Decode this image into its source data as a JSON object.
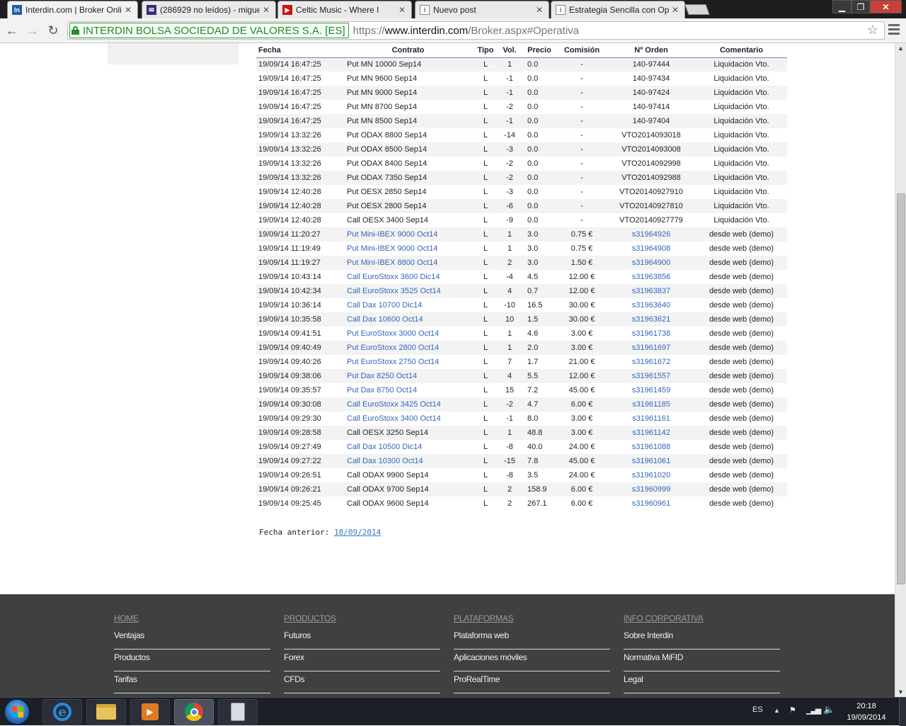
{
  "browser": {
    "tabs": [
      {
        "title": "Interdin.com | Broker Onli",
        "icon": "interdin-icon",
        "active": true
      },
      {
        "title": "(286929 no leídos) - migue",
        "icon": "mail-icon",
        "active": false
      },
      {
        "title": "Celtic Music - Where I",
        "icon": "youtube-icon",
        "active": false
      },
      {
        "title": "Nuevo post",
        "icon": "page-icon",
        "active": false
      },
      {
        "title": "Estrategia Sencilla con Op",
        "icon": "page-icon",
        "active": false
      }
    ],
    "ev_label": "INTERDIN BOLSA SOCIEDAD DE VALORES S.A. [ES]",
    "url_scheme": "https://",
    "url_host": "www.interdin.com",
    "url_path": "/Broker.aspx#Operativa"
  },
  "table": {
    "headers": {
      "fecha": "Fecha",
      "contrato": "Contrato",
      "tipo": "Tipo",
      "vol": "Vol.",
      "precio": "Precio",
      "comision": "Comisión",
      "orden": "Nº Orden",
      "comentario": "Comentario"
    },
    "rows": [
      {
        "fecha": "19/09/14 16:47:25",
        "contrato": "Put MN 10000 Sep14",
        "tipo": "L",
        "vol": "1",
        "precio": "0.0",
        "comision": "-",
        "orden": "140-97444",
        "comentario": "Liquidación Vto.",
        "link": false
      },
      {
        "fecha": "19/09/14 16:47:25",
        "contrato": "Put MN 9600 Sep14",
        "tipo": "L",
        "vol": "-1",
        "precio": "0.0",
        "comision": "-",
        "orden": "140-97434",
        "comentario": "Liquidación Vto.",
        "link": false
      },
      {
        "fecha": "19/09/14 16:47:25",
        "contrato": "Put MN 9000 Sep14",
        "tipo": "L",
        "vol": "-1",
        "precio": "0.0",
        "comision": "-",
        "orden": "140-97424",
        "comentario": "Liquidación Vto.",
        "link": false
      },
      {
        "fecha": "19/09/14 16:47:25",
        "contrato": "Put MN 8700 Sep14",
        "tipo": "L",
        "vol": "-2",
        "precio": "0.0",
        "comision": "-",
        "orden": "140-97414",
        "comentario": "Liquidación Vto.",
        "link": false
      },
      {
        "fecha": "19/09/14 16:47:25",
        "contrato": "Put MN 8500 Sep14",
        "tipo": "L",
        "vol": "-1",
        "precio": "0.0",
        "comision": "-",
        "orden": "140-97404",
        "comentario": "Liquidación Vto.",
        "link": false
      },
      {
        "fecha": "19/09/14 13:32:26",
        "contrato": "Put ODAX 8800 Sep14",
        "tipo": "L",
        "vol": "-14",
        "precio": "0.0",
        "comision": "-",
        "orden": "VTO2014093018",
        "comentario": "Liquidación Vto.",
        "link": false
      },
      {
        "fecha": "19/09/14 13:32:26",
        "contrato": "Put ODAX 8500 Sep14",
        "tipo": "L",
        "vol": "-3",
        "precio": "0.0",
        "comision": "-",
        "orden": "VTO2014093008",
        "comentario": "Liquidación Vto.",
        "link": false
      },
      {
        "fecha": "19/09/14 13:32:26",
        "contrato": "Put ODAX 8400 Sep14",
        "tipo": "L",
        "vol": "-2",
        "precio": "0.0",
        "comision": "-",
        "orden": "VTO2014092998",
        "comentario": "Liquidación Vto.",
        "link": false
      },
      {
        "fecha": "19/09/14 13:32:26",
        "contrato": "Put ODAX 7350 Sep14",
        "tipo": "L",
        "vol": "-2",
        "precio": "0.0",
        "comision": "-",
        "orden": "VTO2014092988",
        "comentario": "Liquidación Vto.",
        "link": false
      },
      {
        "fecha": "19/09/14 12:40:28",
        "contrato": "Put OESX 2850 Sep14",
        "tipo": "L",
        "vol": "-3",
        "precio": "0.0",
        "comision": "-",
        "orden": "VTO20140927910",
        "comentario": "Liquidación Vto.",
        "link": false
      },
      {
        "fecha": "19/09/14 12:40:28",
        "contrato": "Put OESX 2800 Sep14",
        "tipo": "L",
        "vol": "-6",
        "precio": "0.0",
        "comision": "-",
        "orden": "VTO20140927810",
        "comentario": "Liquidación Vto.",
        "link": false
      },
      {
        "fecha": "19/09/14 12:40:28",
        "contrato": "Call OESX 3400 Sep14",
        "tipo": "L",
        "vol": "-9",
        "precio": "0.0",
        "comision": "-",
        "orden": "VTO20140927779",
        "comentario": "Liquidación Vto.",
        "link": false
      },
      {
        "fecha": "19/09/14 11:20:27",
        "contrato": "Put Mini-IBEX 9000 Oct14",
        "tipo": "L",
        "vol": "1",
        "precio": "3.0",
        "comision": "0.75 €",
        "orden": "s31964926",
        "comentario": "desde web (demo)",
        "link": true
      },
      {
        "fecha": "19/09/14 11:19:49",
        "contrato": "Put Mini-IBEX 9000 Oct14",
        "tipo": "L",
        "vol": "1",
        "precio": "3.0",
        "comision": "0.75 €",
        "orden": "s31964908",
        "comentario": "desde web (demo)",
        "link": true
      },
      {
        "fecha": "19/09/14 11:19:27",
        "contrato": "Put Mini-IBEX 8800 Oct14",
        "tipo": "L",
        "vol": "2",
        "precio": "3.0",
        "comision": "1.50 €",
        "orden": "s31964900",
        "comentario": "desde web (demo)",
        "link": true
      },
      {
        "fecha": "19/09/14 10:43:14",
        "contrato": "Call EuroStoxx 3600 Dic14",
        "tipo": "L",
        "vol": "-4",
        "precio": "4.5",
        "comision": "12.00 €",
        "orden": "s31963856",
        "comentario": "desde web (demo)",
        "link": true
      },
      {
        "fecha": "19/09/14 10:42:34",
        "contrato": "Call EuroStoxx 3525 Oct14",
        "tipo": "L",
        "vol": "4",
        "precio": "0.7",
        "comision": "12.00 €",
        "orden": "s31963837",
        "comentario": "desde web (demo)",
        "link": true
      },
      {
        "fecha": "19/09/14 10:36:14",
        "contrato": "Call Dax 10700 Dic14",
        "tipo": "L",
        "vol": "-10",
        "precio": "16.5",
        "comision": "30.00 €",
        "orden": "s31963640",
        "comentario": "desde web (demo)",
        "link": true
      },
      {
        "fecha": "19/09/14 10:35:58",
        "contrato": "Call Dax 10600 Oct14",
        "tipo": "L",
        "vol": "10",
        "precio": "1.5",
        "comision": "30.00 €",
        "orden": "s31963621",
        "comentario": "desde web (demo)",
        "link": true
      },
      {
        "fecha": "19/09/14 09:41:51",
        "contrato": "Put EuroStoxx 3000 Oct14",
        "tipo": "L",
        "vol": "1",
        "precio": "4.6",
        "comision": "3.00 €",
        "orden": "s31961738",
        "comentario": "desde web (demo)",
        "link": true
      },
      {
        "fecha": "19/09/14 09:40:49",
        "contrato": "Put EuroStoxx 2800 Oct14",
        "tipo": "L",
        "vol": "1",
        "precio": "2.0",
        "comision": "3.00 €",
        "orden": "s31961697",
        "comentario": "desde web (demo)",
        "link": true
      },
      {
        "fecha": "19/09/14 09:40:26",
        "contrato": "Put EuroStoxx 2750 Oct14",
        "tipo": "L",
        "vol": "7",
        "precio": "1.7",
        "comision": "21.00 €",
        "orden": "s31961672",
        "comentario": "desde web (demo)",
        "link": true
      },
      {
        "fecha": "19/09/14 09:38:06",
        "contrato": "Put Dax 8250 Oct14",
        "tipo": "L",
        "vol": "4",
        "precio": "5.5",
        "comision": "12.00 €",
        "orden": "s31961557",
        "comentario": "desde web (demo)",
        "link": true
      },
      {
        "fecha": "19/09/14 09:35:57",
        "contrato": "Put Dax 8750 Oct14",
        "tipo": "L",
        "vol": "15",
        "precio": "7.2",
        "comision": "45.00 €",
        "orden": "s31961459",
        "comentario": "desde web (demo)",
        "link": true
      },
      {
        "fecha": "19/09/14 09:30:08",
        "contrato": "Call EuroStoxx 3425 Oct14",
        "tipo": "L",
        "vol": "-2",
        "precio": "4.7",
        "comision": "6.00 €",
        "orden": "s31961185",
        "comentario": "desde web (demo)",
        "link": true
      },
      {
        "fecha": "19/09/14 09:29:30",
        "contrato": "Call EuroStoxx 3400 Oct14",
        "tipo": "L",
        "vol": "-1",
        "precio": "8.0",
        "comision": "3.00 €",
        "orden": "s31961161",
        "comentario": "desde web (demo)",
        "link": true
      },
      {
        "fecha": "19/09/14 09:28:58",
        "contrato": "Call OESX 3250 Sep14",
        "tipo": "L",
        "vol": "1",
        "precio": "48.8",
        "comision": "3.00 €",
        "orden": "s31961142",
        "comentario": "desde web (demo)",
        "link": false
      },
      {
        "fecha": "19/09/14 09:27:49",
        "contrato": "Call Dax 10500 Dic14",
        "tipo": "L",
        "vol": "-8",
        "precio": "40.0",
        "comision": "24.00 €",
        "orden": "s31961088",
        "comentario": "desde web (demo)",
        "link": true
      },
      {
        "fecha": "19/09/14 09:27:22",
        "contrato": "Call Dax 10300 Oct14",
        "tipo": "L",
        "vol": "-15",
        "precio": "7.8",
        "comision": "45.00 €",
        "orden": "s31961061",
        "comentario": "desde web (demo)",
        "link": true
      },
      {
        "fecha": "19/09/14 09:26:51",
        "contrato": "Call ODAX 9900 Sep14",
        "tipo": "L",
        "vol": "-8",
        "precio": "3.5",
        "comision": "24.00 €",
        "orden": "s31961020",
        "comentario": "desde web (demo)",
        "link": false
      },
      {
        "fecha": "19/09/14 09:26:21",
        "contrato": "Call ODAX 9700 Sep14",
        "tipo": "L",
        "vol": "2",
        "precio": "158.9",
        "comision": "6.00 €",
        "orden": "s31960999",
        "comentario": "desde web (demo)",
        "link": false
      },
      {
        "fecha": "19/09/14 09:25:45",
        "contrato": "Call ODAX 9600 Sep14",
        "tipo": "L",
        "vol": "2",
        "precio": "267.1",
        "comision": "6.00 €",
        "orden": "s31960961",
        "comentario": "desde web (demo)",
        "link": false
      }
    ]
  },
  "previous": {
    "label": "Fecha anterior: ",
    "date": "18/09/2014"
  },
  "footer": {
    "columns": [
      {
        "heading": "HOME",
        "items": [
          "Ventajas",
          "Productos",
          "Tarifas"
        ]
      },
      {
        "heading": "PRODUCTOS",
        "items": [
          "Futuros",
          "Forex",
          "CFDs"
        ]
      },
      {
        "heading": "PLATAFORMAS",
        "items": [
          "Plataforma web",
          "Aplicaciones móviles",
          "ProRealTime"
        ]
      },
      {
        "heading": "INFO CORPORATIVA",
        "items": [
          "Sobre Interdin",
          "Normativa MiFID",
          "Legal"
        ]
      }
    ]
  },
  "taskbar": {
    "language": "ES",
    "time": "20:18",
    "date": "19/09/2014",
    "apps": [
      "internet-explorer-icon",
      "file-explorer-icon",
      "media-player-icon",
      "chrome-icon",
      "calculator-icon"
    ]
  },
  "colors": {
    "link": "#3366bb",
    "ev_green": "#2a8a2a",
    "footer_bg": "#404040"
  }
}
